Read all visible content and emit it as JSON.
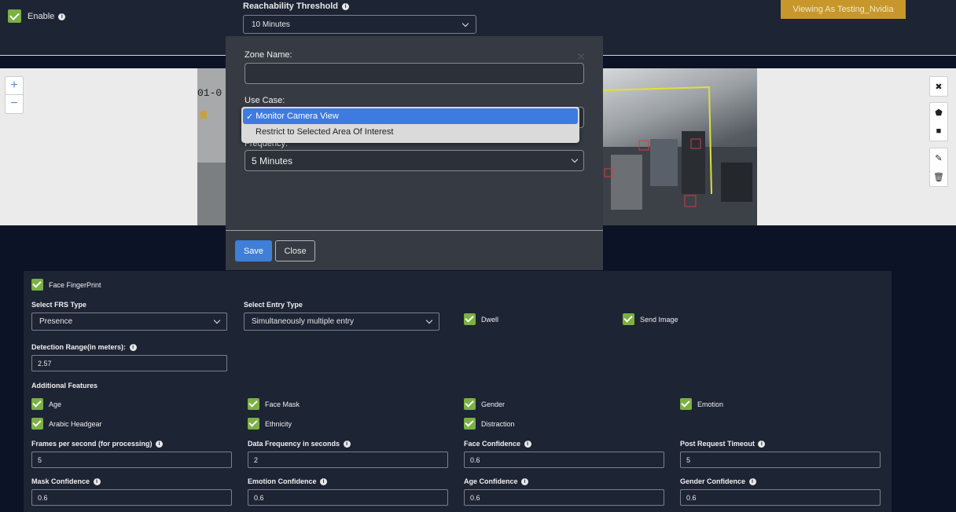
{
  "topbar": {
    "enable_label": "Enable",
    "reachability_label": "Reachability Threshold",
    "reachability_value": "10 Minutes",
    "viewing_as": "Viewing As Testing_Nvidia"
  },
  "canvas": {
    "timestamp_fragment": "01-0",
    "zoom_in": "+",
    "zoom_out": "−"
  },
  "modal": {
    "zone_name_label": "Zone Name:",
    "zone_name_value": "",
    "use_case_label": "Use Case:",
    "frequency_label": "Frequency:",
    "frequency_value": "5 Minutes",
    "save_label": "Save",
    "close_label": "Close",
    "use_case_options": [
      {
        "label": "Monitor Camera View",
        "selected": true
      },
      {
        "label": "Restrict to Selected Area Of Interest",
        "selected": false
      }
    ]
  },
  "panel": {
    "face_fingerprint": "Face FingerPrint",
    "frs_type_label": "Select FRS Type",
    "frs_type_value": "Presence",
    "entry_type_label": "Select Entry Type",
    "entry_type_value": "Simultaneously multiple entry",
    "dwell": "Dwell",
    "send_image": "Send Image",
    "detection_range_label": "Detection Range(in meters):",
    "detection_range_value": "2.57",
    "additional_features": "Additional Features",
    "features": {
      "age": "Age",
      "face_mask": "Face Mask",
      "gender": "Gender",
      "emotion": "Emotion",
      "arabic_headgear": "Arabic Headgear",
      "ethnicity": "Ethnicity",
      "distraction": "Distraction"
    },
    "fields": {
      "fps_label": "Frames per second (for processing)",
      "fps_value": "5",
      "data_freq_label": "Data Frequency in seconds",
      "data_freq_value": "2",
      "face_conf_label": "Face Confidence",
      "face_conf_value": "0.6",
      "post_timeout_label": "Post Request Timeout",
      "post_timeout_value": "5",
      "mask_conf_label": "Mask Confidence",
      "mask_conf_value": "0.6",
      "emotion_conf_label": "Emotion Confidence",
      "emotion_conf_value": "0.6",
      "age_conf_label": "Age Confidence",
      "age_conf_value": "0.6",
      "gender_conf_label": "Gender Confidence",
      "gender_conf_value": "0.6"
    }
  },
  "colors": {
    "accent_green": "#7bb043",
    "primary_blue": "#3f7fd8",
    "badge_gold": "#c7972b",
    "panel_bg": "#1d2434",
    "modal_bg": "#363b43"
  }
}
